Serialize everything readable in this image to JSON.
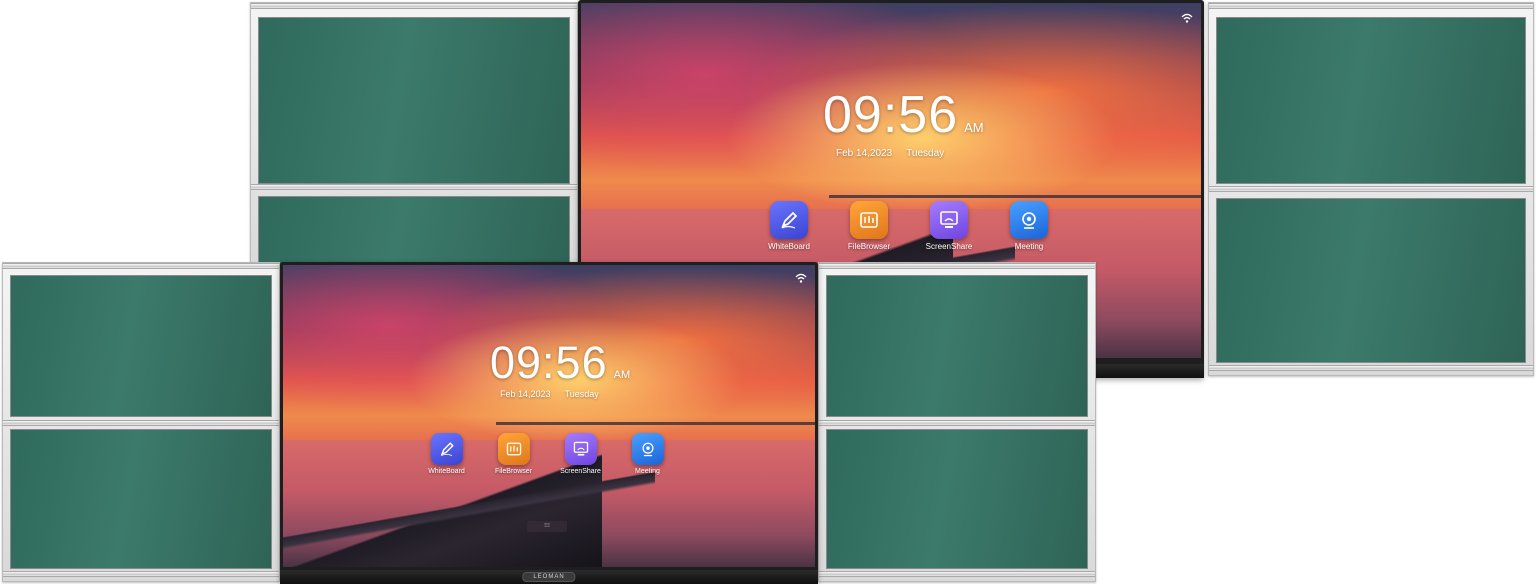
{
  "colors": {
    "board_green": "#3c7a6b",
    "frame_silver": "#d9d9d9",
    "bezel": "#1e1e1e"
  },
  "home_screen": {
    "time": "09:56",
    "ampm": "AM",
    "date": "Feb 14,2023",
    "weekday": "Tuesday",
    "apps": [
      {
        "label": "WhiteBoard",
        "icon": "pencil-icon",
        "color": "#4a57e0"
      },
      {
        "label": "FileBrowser",
        "icon": "folder-icon",
        "color": "#f08a1e"
      },
      {
        "label": "ScreenShare",
        "icon": "screen-cast-icon",
        "color": "#8a5cf0"
      },
      {
        "label": "Meeting",
        "icon": "webcam-icon",
        "color": "#2a7ff0"
      }
    ],
    "status_icon": "wifi-icon"
  },
  "device": {
    "brand": "LEOMAN",
    "dock_hint": "⁝⁝⁝"
  }
}
